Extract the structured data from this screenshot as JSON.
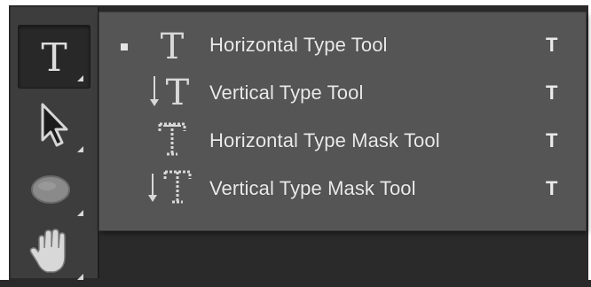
{
  "toolbar": {
    "tools": [
      {
        "name": "Type",
        "icon": "type-tool-icon",
        "active": true,
        "has_submenu": true
      },
      {
        "name": "Move",
        "icon": "arrow-cursor-icon",
        "active": false,
        "has_submenu": true
      },
      {
        "name": "Shape",
        "icon": "ellipse-icon",
        "active": false,
        "has_submenu": true
      },
      {
        "name": "Hand",
        "icon": "hand-icon",
        "active": false,
        "has_submenu": true
      }
    ]
  },
  "flyout_menu": {
    "items": [
      {
        "label": "Horizontal Type Tool",
        "shortcut": "T",
        "icon": "horizontal-type-icon",
        "selected": true
      },
      {
        "label": "Vertical Type Tool",
        "shortcut": "T",
        "icon": "vertical-type-icon",
        "selected": false
      },
      {
        "label": "Horizontal Type Mask Tool",
        "shortcut": "T",
        "icon": "horizontal-type-mask-icon",
        "selected": false
      },
      {
        "label": "Vertical Type Mask Tool",
        "shortcut": "T",
        "icon": "vertical-type-mask-icon",
        "selected": false
      }
    ]
  },
  "colors": {
    "panel_bg": "#3d3d3d",
    "active_tool_bg": "#282828",
    "menu_bg": "#555555",
    "menu_text": "#eaeaea"
  }
}
